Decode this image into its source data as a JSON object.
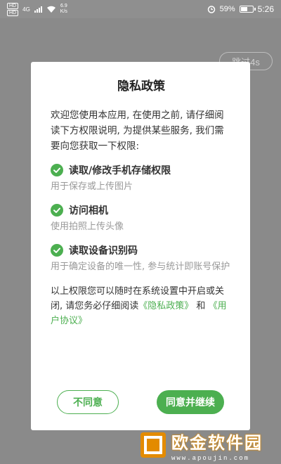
{
  "status_bar": {
    "sim1": "HD",
    "sim2": "HD",
    "network": "4G",
    "speed_value": "6.9",
    "speed_unit": "K/s",
    "battery_percent": "59%",
    "battery_level": 0.59,
    "time": "5:26",
    "alarm_icon": "alarm-clock-icon",
    "wifi_icon": "wifi-icon"
  },
  "background": {
    "skip_label": "跳过4s"
  },
  "dialog": {
    "title": "隐私政策",
    "intro": "欢迎您使用本应用, 在使用之前, 请仔细阅读下方权限说明, 为提供某些服务, 我们需要向您获取一下权限:",
    "permissions": [
      {
        "title": "读取/修改手机存储权限",
        "desc": "用于保存或上传图片",
        "icon": "check-circle-icon"
      },
      {
        "title": "访问相机",
        "desc": "使用拍照上传头像",
        "icon": "check-circle-icon"
      },
      {
        "title": "读取设备识别码",
        "desc": "用于确定设备的唯一性, 参与统计即账号保护",
        "icon": "check-circle-icon"
      }
    ],
    "outro_text": "以上权限您可以随时在系统设置中开启或关闭, 请您务必仔细阅读",
    "privacy_link": "《隐私政策》",
    "and_text": "和",
    "agreement_link": "《用户协议》",
    "decline_label": "不同意",
    "accept_label": "同意并继续"
  },
  "watermark": {
    "name": "欧金软件园",
    "url": "www.apoujin.com"
  },
  "colors": {
    "accent": "#4caf50",
    "overlay": "#8a8a8a",
    "muted_text": "#999999",
    "watermark_orange": "#e38b00"
  }
}
